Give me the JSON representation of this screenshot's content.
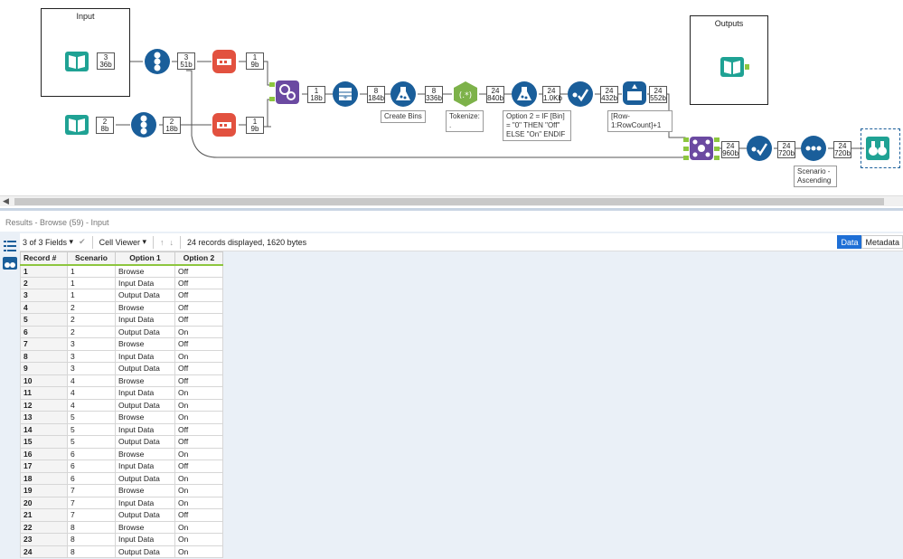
{
  "canvas": {
    "containers": [
      {
        "title": "Input"
      },
      {
        "title": "Outputs"
      }
    ],
    "badges": [
      {
        "line1": "3",
        "line2": "36b"
      },
      {
        "line1": "3",
        "line2": "51b"
      },
      {
        "line1": "1",
        "line2": "9b"
      },
      {
        "line1": "2",
        "line2": "8b"
      },
      {
        "line1": "2",
        "line2": "18b"
      },
      {
        "line1": "1",
        "line2": "9b"
      },
      {
        "line1": "1",
        "line2": "18b"
      },
      {
        "line1": "8",
        "line2": "184b"
      },
      {
        "line1": "8",
        "line2": "336b"
      },
      {
        "line1": "24",
        "line2": "840b"
      },
      {
        "line1": "24",
        "line2": "1.0Kb"
      },
      {
        "line1": "24",
        "line2": "432b"
      },
      {
        "line1": "24",
        "line2": "552b"
      },
      {
        "line1": "24",
        "line2": "960b"
      },
      {
        "line1": "24",
        "line2": "720b"
      },
      {
        "line1": "24",
        "line2": "720b"
      }
    ],
    "annotations": [
      {
        "text": "Create Bins"
      },
      {
        "text": "Tokenize: ."
      },
      {
        "text": "Option 2 = IF [Bin] = \"0\" THEN \"Off\" ELSE \"On\" ENDIF"
      },
      {
        "text": "[Row-1:RowCount]+1"
      },
      {
        "text": "Scenario - Ascending"
      }
    ],
    "icons": [
      "input-data-icon",
      "record-id-icon",
      "sample-icon",
      "append-fields-icon",
      "generate-rows-icon",
      "formula-icon",
      "regex-icon",
      "select-icon",
      "multi-row-formula-icon",
      "join-multiple-icon",
      "sort-icon",
      "browse-icon",
      "output-data-icon"
    ]
  },
  "results": {
    "header": "Results - Browse (59) - Input",
    "fields_label": "3 of 3 Fields",
    "viewer_label": "Cell Viewer",
    "records_info": "24 records displayed, 1620 bytes",
    "tab_data": "Data",
    "tab_metadata": "Metadata",
    "columns": [
      "Record #",
      "Scenario",
      "Option 1",
      "Option 2"
    ],
    "rows": [
      [
        "1",
        "1",
        "Browse",
        "Off"
      ],
      [
        "2",
        "1",
        "Input Data",
        "Off"
      ],
      [
        "3",
        "1",
        "Output Data",
        "Off"
      ],
      [
        "4",
        "2",
        "Browse",
        "Off"
      ],
      [
        "5",
        "2",
        "Input Data",
        "Off"
      ],
      [
        "6",
        "2",
        "Output Data",
        "On"
      ],
      [
        "7",
        "3",
        "Browse",
        "Off"
      ],
      [
        "8",
        "3",
        "Input Data",
        "On"
      ],
      [
        "9",
        "3",
        "Output Data",
        "Off"
      ],
      [
        "10",
        "4",
        "Browse",
        "Off"
      ],
      [
        "11",
        "4",
        "Input Data",
        "On"
      ],
      [
        "12",
        "4",
        "Output Data",
        "On"
      ],
      [
        "13",
        "5",
        "Browse",
        "On"
      ],
      [
        "14",
        "5",
        "Input Data",
        "Off"
      ],
      [
        "15",
        "5",
        "Output Data",
        "Off"
      ],
      [
        "16",
        "6",
        "Browse",
        "On"
      ],
      [
        "17",
        "6",
        "Input Data",
        "Off"
      ],
      [
        "18",
        "6",
        "Output Data",
        "On"
      ],
      [
        "19",
        "7",
        "Browse",
        "On"
      ],
      [
        "20",
        "7",
        "Input Data",
        "On"
      ],
      [
        "21",
        "7",
        "Output Data",
        "Off"
      ],
      [
        "22",
        "8",
        "Browse",
        "On"
      ],
      [
        "23",
        "8",
        "Input Data",
        "On"
      ],
      [
        "24",
        "8",
        "Output Data",
        "On"
      ]
    ]
  },
  "colors": {
    "accent_green": "#8dc63f",
    "teal": "#1fa294",
    "navy": "#1a5e9a",
    "red_orange": "#e2513f",
    "purple": "#6b4aa1",
    "olive": "#7db24a",
    "tab_active": "#1e6fd6"
  }
}
